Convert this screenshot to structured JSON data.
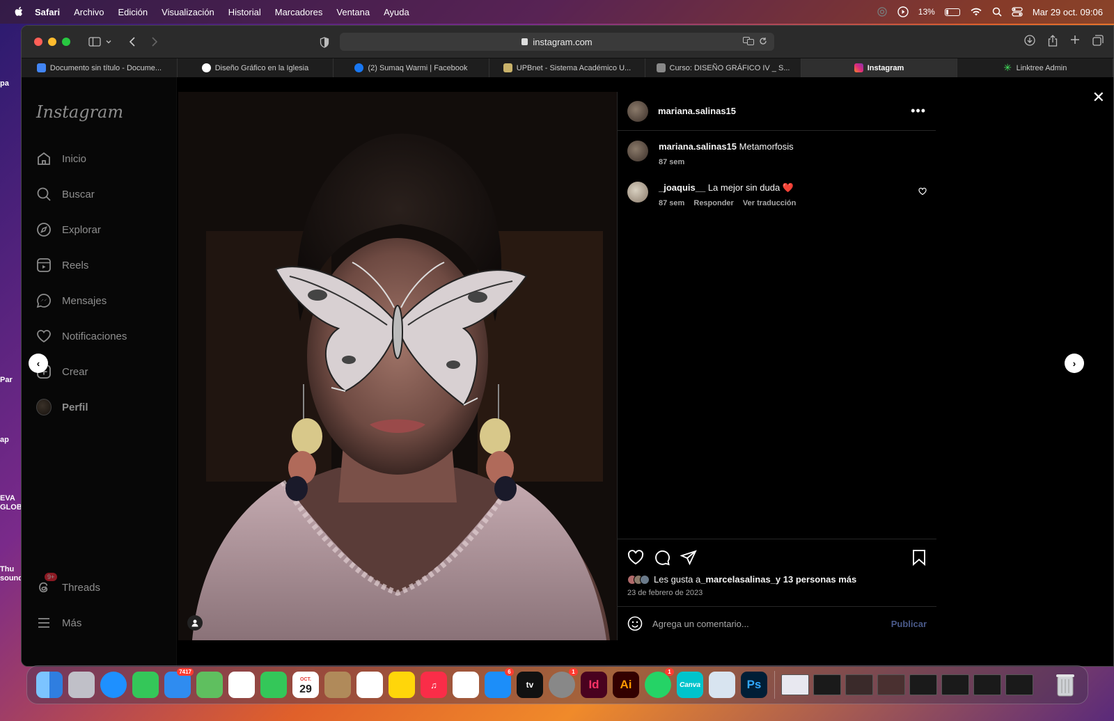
{
  "menubar": {
    "app": "Safari",
    "items": [
      "Archivo",
      "Edición",
      "Visualización",
      "Historial",
      "Marcadores",
      "Ventana",
      "Ayuda"
    ],
    "battery": "13%",
    "datetime": "Mar 29 oct.  09:06"
  },
  "desktop": {
    "labels": [
      "pa",
      "Par",
      "ap",
      "EVA GLOB",
      "Thu sound"
    ]
  },
  "browser": {
    "url": "instagram.com",
    "tabs": [
      {
        "title": "Documento sin título - Docume...",
        "icon": "google-docs-icon",
        "color": "#4285f4"
      },
      {
        "title": "Diseño Gráfico en la Iglesia",
        "icon": "openai-icon",
        "color": "#ffffff"
      },
      {
        "title": "(2) Sumaq Warmi | Facebook",
        "icon": "facebook-icon",
        "color": "#1877f2"
      },
      {
        "title": "UPBnet - Sistema Académico U...",
        "icon": "upb-icon",
        "color": "#c9b26a"
      },
      {
        "title": "Curso: DISEÑO GRÁFICO IV _ S...",
        "icon": "moodle-icon",
        "color": "#888888"
      },
      {
        "title": "Instagram",
        "icon": "instagram-icon",
        "color": "#e1306c"
      },
      {
        "title": "Linktree Admin",
        "icon": "linktree-icon",
        "color": "#43e55e"
      }
    ]
  },
  "instagram": {
    "logo": "Instagram",
    "nav": [
      {
        "label": "Inicio",
        "icon": "home-icon"
      },
      {
        "label": "Buscar",
        "icon": "search-icon"
      },
      {
        "label": "Explorar",
        "icon": "explore-icon"
      },
      {
        "label": "Reels",
        "icon": "reels-icon"
      },
      {
        "label": "Mensajes",
        "icon": "messages-icon"
      },
      {
        "label": "Notificaciones",
        "icon": "heart-icon"
      },
      {
        "label": "Crear",
        "icon": "create-icon"
      },
      {
        "label": "Perfil",
        "icon": "profile-avatar"
      }
    ],
    "threads": {
      "label": "Threads",
      "badge": "9+"
    },
    "more": "Más",
    "post": {
      "username": "mariana.salinas15",
      "caption": "Metamorfosis",
      "caption_time": "87 sem",
      "comments": [
        {
          "username": "_joaquis__",
          "text": "La mejor sin duda ❤️",
          "time": "87 sem",
          "reply": "Responder",
          "translate": "Ver traducción"
        }
      ],
      "likes_prefix": "Les gusta a ",
      "likes_user": "_marcelasalinas_",
      "likes_suffix": " y 13 personas más",
      "date": "23 de febrero de 2023",
      "comment_placeholder": "Agrega un comentario...",
      "publish": "Publicar"
    }
  },
  "dock": {
    "apps": [
      {
        "name": "Finder",
        "icon": "finder-icon",
        "color": "#3a8ee6"
      },
      {
        "name": "Launchpad",
        "icon": "launchpad-icon",
        "color": "#c0c0c8"
      },
      {
        "name": "Safari",
        "icon": "safari-icon",
        "color": "#1e90ff"
      },
      {
        "name": "Messages",
        "icon": "messages-app-icon",
        "color": "#34c759"
      },
      {
        "name": "Mail",
        "icon": "mail-icon",
        "color": "#2f8cf0",
        "badge": "7417"
      },
      {
        "name": "Maps",
        "icon": "maps-icon",
        "color": "#5fbf5f"
      },
      {
        "name": "Photos",
        "icon": "photos-icon",
        "color": "#ffffff"
      },
      {
        "name": "FaceTime",
        "icon": "facetime-icon",
        "color": "#34c759"
      },
      {
        "name": "Calendar",
        "icon": "calendar-icon",
        "color": "#ffffff",
        "text": "29",
        "month": "OCT."
      },
      {
        "name": "Contacts",
        "icon": "contacts-icon",
        "color": "#b08a5a"
      },
      {
        "name": "Reminders",
        "icon": "reminders-icon",
        "color": "#ffffff"
      },
      {
        "name": "Notes",
        "icon": "notes-icon",
        "color": "#ffd60a"
      },
      {
        "name": "Music",
        "icon": "music-icon",
        "color": "#fa2d48"
      },
      {
        "name": "Freeform",
        "icon": "freeform-icon",
        "color": "#ffffff"
      },
      {
        "name": "App Store",
        "icon": "appstore-icon",
        "color": "#1c8ef9",
        "badge": "6"
      },
      {
        "name": "Apple TV",
        "icon": "appletv-icon",
        "color": "#111111",
        "text": "tv"
      },
      {
        "name": "System Settings",
        "icon": "settings-icon",
        "color": "#888888",
        "badge": "1"
      },
      {
        "name": "InDesign",
        "icon": "indesign-icon",
        "color": "#49021f",
        "text": "Id"
      },
      {
        "name": "Illustrator",
        "icon": "illustrator-icon",
        "color": "#330000",
        "text": "Ai"
      },
      {
        "name": "WhatsApp",
        "icon": "whatsapp-icon",
        "color": "#25d366",
        "badge": "1"
      },
      {
        "name": "Canva",
        "icon": "canva-icon",
        "color": "#00c4cc",
        "text": "Canva"
      },
      {
        "name": "Preview",
        "icon": "preview-icon",
        "color": "#d8e4f0"
      },
      {
        "name": "Photoshop",
        "icon": "photoshop-icon",
        "color": "#001e36",
        "text": "Ps"
      }
    ],
    "trash": "trash-icon"
  }
}
